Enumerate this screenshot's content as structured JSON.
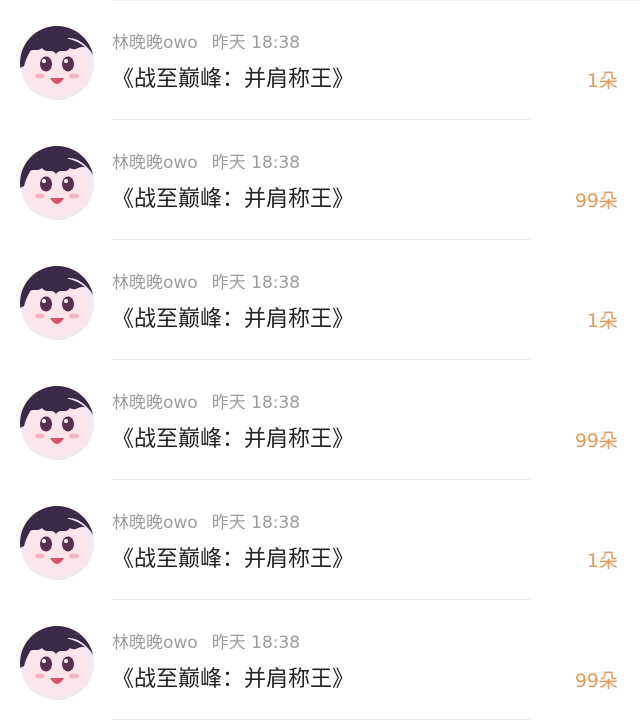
{
  "items": [
    {
      "username": "林晚晚owo",
      "time": "昨天 18:38",
      "title": "《战至巅峰：并肩称王》",
      "amount": "1朵",
      "avatar_icon": "anime-girl-avatar-icon"
    },
    {
      "username": "林晚晚owo",
      "time": "昨天 18:38",
      "title": "《战至巅峰：并肩称王》",
      "amount": "99朵",
      "avatar_icon": "anime-girl-avatar-icon"
    },
    {
      "username": "林晚晚owo",
      "time": "昨天 18:38",
      "title": "《战至巅峰：并肩称王》",
      "amount": "1朵",
      "avatar_icon": "anime-girl-avatar-icon"
    },
    {
      "username": "林晚晚owo",
      "time": "昨天 18:38",
      "title": "《战至巅峰：并肩称王》",
      "amount": "99朵",
      "avatar_icon": "anime-girl-avatar-icon"
    },
    {
      "username": "林晚晚owo",
      "time": "昨天 18:38",
      "title": "《战至巅峰：并肩称王》",
      "amount": "1朵",
      "avatar_icon": "anime-girl-avatar-icon"
    },
    {
      "username": "林晚晚owo",
      "time": "昨天 18:38",
      "title": "《战至巅峰：并肩称王》",
      "amount": "99朵",
      "avatar_icon": "anime-girl-avatar-icon"
    }
  ],
  "colors": {
    "amount": "#e09a5a",
    "meta_text": "#9d9d9d",
    "title_text": "#222222",
    "divider": "#ededed"
  }
}
